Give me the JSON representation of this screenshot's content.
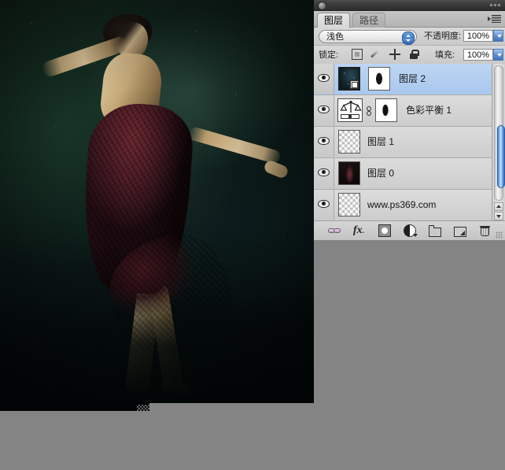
{
  "app": {
    "panel_title": "",
    "tabs": [
      {
        "label": "图层",
        "active": true
      },
      {
        "label": "路径",
        "active": false
      }
    ],
    "panel_menu_icon": "panel-menu-icon"
  },
  "controls": {
    "blend_mode": "浅色",
    "opacity_label": "不透明度:",
    "opacity_value": "100%",
    "lock_label": "锁定:",
    "lock_icons": [
      "lock-transparent-pixels",
      "lock-image-pixels",
      "lock-position",
      "lock-all"
    ],
    "fill_label": "填充:",
    "fill_value": "100%"
  },
  "layers": [
    {
      "name": "图层 2",
      "visible": true,
      "selected": true,
      "thumb": "sky",
      "has_mask": true,
      "mask_thumb": "mask",
      "smart_object": true,
      "linked": false
    },
    {
      "name": "色彩平衡 1",
      "visible": true,
      "selected": false,
      "thumb": "adjustment-color-balance",
      "has_mask": true,
      "mask_thumb": "mask2",
      "smart_object": false,
      "linked": true
    },
    {
      "name": "图层 1",
      "visible": true,
      "selected": false,
      "thumb": "transparent",
      "has_mask": false,
      "smart_object": false,
      "linked": false
    },
    {
      "name": "图层 0",
      "visible": true,
      "selected": false,
      "thumb": "art",
      "has_mask": false,
      "smart_object": false,
      "linked": false
    },
    {
      "name": "www.ps369.com",
      "visible": true,
      "selected": false,
      "thumb": "transparent",
      "has_mask": false,
      "smart_object": false,
      "linked": false
    }
  ],
  "toolbar": {
    "items": [
      {
        "name": "link-layers-icon",
        "title": "链接图层"
      },
      {
        "name": "layer-style-fx-icon",
        "title": "添加图层样式",
        "text": "fx"
      },
      {
        "name": "layer-mask-icon",
        "title": "添加图层蒙版"
      },
      {
        "name": "adjustment-layer-icon",
        "title": "创建新的填充或调整图层"
      },
      {
        "name": "new-group-icon",
        "title": "创建新组"
      },
      {
        "name": "new-layer-icon",
        "title": "创建新图层"
      },
      {
        "name": "delete-layer-icon",
        "title": "删除图层"
      }
    ]
  },
  "scrollbar": {
    "up_arrow": "scroll-up-icon",
    "down_arrow": "scroll-down-icon"
  },
  "colors": {
    "panel_bg": "#d4d4d4",
    "selected_row": "#b6cfef",
    "desktop_gray": "#848484",
    "scroll_thumb": "#4f90da",
    "titlebar": "#3a3a3a"
  }
}
